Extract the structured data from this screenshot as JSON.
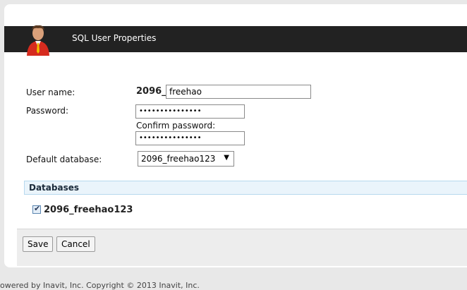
{
  "header": {
    "title": "SQL User Properties"
  },
  "form": {
    "username_label": "User name:",
    "username_prefix": "2096_",
    "username_value": "freehao",
    "password_label": "Password:",
    "password_dots": "•••••••••••••••",
    "confirm_label": "Confirm password:",
    "confirm_dots": "•••••••••••••••",
    "default_db_label": "Default database:",
    "default_db_value": "2096_freehao123"
  },
  "databases": {
    "title": "Databases",
    "items": [
      {
        "label": "2096_freehao123",
        "checked": true
      }
    ]
  },
  "buttons": {
    "save": "Save",
    "cancel": "Cancel"
  },
  "footer": {
    "text": "owered by Inavit, Inc. Copyright © 2013 Inavit, Inc."
  }
}
